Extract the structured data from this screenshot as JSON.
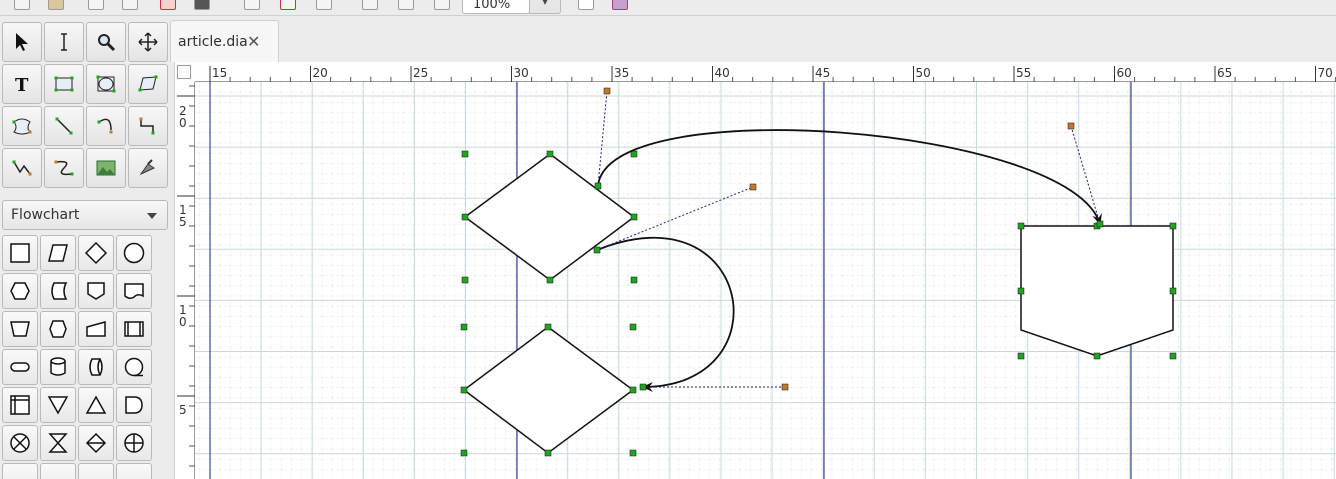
{
  "toolbar": {
    "zoom_value": "100%",
    "zoom_dropdown_icon": "chevron-down-icon"
  },
  "toolbox": {
    "tools": [
      {
        "name": "select-tool",
        "icon": "pointer-arrow-icon"
      },
      {
        "name": "text-edit-tool",
        "icon": "text-cursor-icon"
      },
      {
        "name": "magnify-tool",
        "icon": "magnifier-icon"
      },
      {
        "name": "scroll-tool",
        "icon": "move-arrows-icon"
      },
      {
        "name": "text-tool",
        "icon": "text-t-icon"
      },
      {
        "name": "box-tool",
        "icon": "box-icon"
      },
      {
        "name": "ellipse-tool",
        "icon": "ellipse-icon"
      },
      {
        "name": "polygon-tool",
        "icon": "polygon-icon"
      },
      {
        "name": "beziergon-tool",
        "icon": "beziergon-icon"
      },
      {
        "name": "line-tool",
        "icon": "line-icon"
      },
      {
        "name": "arc-tool",
        "icon": "arc-icon"
      },
      {
        "name": "zigzag-line-tool",
        "icon": "zigzag-line-icon"
      },
      {
        "name": "polyline-tool",
        "icon": "polyline-icon"
      },
      {
        "name": "bezier-line-tool",
        "icon": "bezier-line-icon"
      },
      {
        "name": "image-tool",
        "icon": "image-icon"
      },
      {
        "name": "outline-tool",
        "icon": "outline-icon"
      }
    ],
    "sheet_label": "Flowchart",
    "shapes": [
      "box-shape-icon",
      "parallelogram-shape-icon",
      "diamond-shape-icon",
      "circle-shape-icon",
      "preparation-shape-icon",
      "stored-data-shape-icon",
      "offpage-connector-shape-icon",
      "document-shape-icon",
      "manual-operation-shape-icon",
      "hexagon-shape-icon",
      "manual-input-shape-icon",
      "predefined-process-shape-icon",
      "terminal-shape-icon",
      "magnetic-disk-shape-icon",
      "direct-data-shape-icon",
      "sequential-data-shape-icon",
      "internal-storage-shape-icon",
      "merge-shape-icon",
      "extract-shape-icon",
      "delay-shape-icon",
      "summing-junction-shape-icon",
      "collate-shape-icon",
      "sort-shape-icon",
      "or-shape-icon"
    ]
  },
  "tabs": [
    {
      "label": "article.dia",
      "close_icon": "✕"
    }
  ],
  "rulers": {
    "horizontal_ticks": [
      "15",
      "20",
      "25",
      "30",
      "35",
      "40",
      "45",
      "50",
      "55",
      "60",
      "65",
      "70"
    ],
    "vertical_ticks": [
      "2",
      "0",
      "1",
      "5",
      "1",
      "0",
      "5"
    ]
  },
  "colors": {
    "handle_green": "#1fa51f",
    "handle_orange": "#c07a2e",
    "guide_blue": "#1b1f7a",
    "grid_major": "#c8d8dc",
    "grid_minor": "#dfe9ec"
  }
}
